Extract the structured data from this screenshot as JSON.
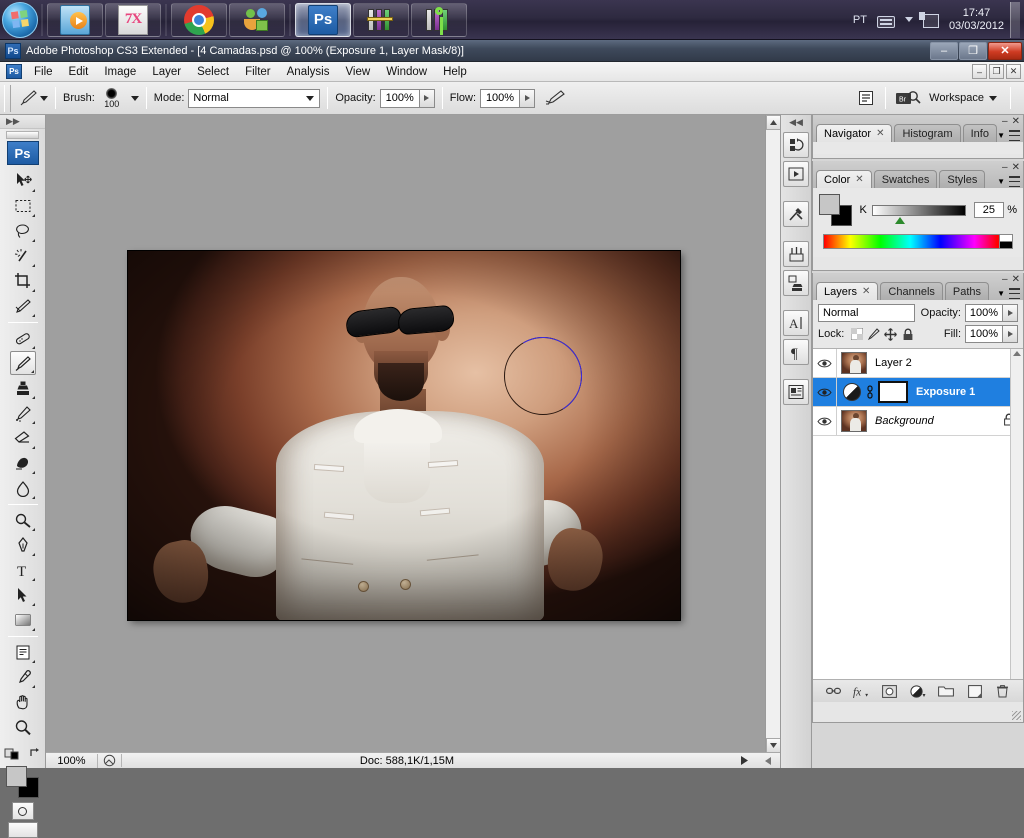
{
  "taskbar": {
    "start_label": "Start",
    "buttons": [
      {
        "name": "media-player",
        "label": "Windows Media Player"
      },
      {
        "name": "7x-app",
        "label": "7X"
      },
      {
        "name": "google-chrome",
        "label": "Google Chrome"
      },
      {
        "name": "messenger",
        "label": "Messenger"
      },
      {
        "name": "photoshop",
        "label": "Ps",
        "active": true
      },
      {
        "name": "winrar",
        "label": "WinRAR"
      },
      {
        "name": "winrar-key",
        "label": "WinRAR Key"
      }
    ],
    "tray": {
      "language": "PT",
      "keyboard_icon": "keyboard-icon",
      "network_icon": "network-icon",
      "time": "17:47",
      "date": "03/03/2012"
    }
  },
  "window": {
    "app_badge": "Ps",
    "title": "Adobe Photoshop CS3 Extended - [4 Camadas.psd @ 100% (Exposure 1, Layer Mask/8)]",
    "minimize": "–",
    "restore": "❐",
    "close": "✕"
  },
  "menubar": {
    "app_icon": "Ps",
    "items": [
      "File",
      "Edit",
      "Image",
      "Layer",
      "Select",
      "Filter",
      "Analysis",
      "View",
      "Window",
      "Help"
    ],
    "doc_minimize": "–",
    "doc_restore": "❐",
    "doc_close": "✕"
  },
  "optionsbar": {
    "tool_icon": "brush-tool-icon",
    "brush_label": "Brush:",
    "brush_size": "100",
    "mode_label": "Mode:",
    "mode_value": "Normal",
    "opacity_label": "Opacity:",
    "opacity_value": "100%",
    "flow_label": "Flow:",
    "flow_value": "100%",
    "airbrush_icon": "airbrush-icon",
    "palettes_icon": "palettes-toggle-icon",
    "bridge_icon": "go-to-bridge-icon",
    "workspace_label": "Workspace"
  },
  "toolbox": {
    "collapse_icon": "collapse-arrows-icon",
    "app_button": "Ps",
    "tools": [
      {
        "name": "move-tool",
        "label": "Move Tool"
      },
      {
        "name": "rectangular-marquee-tool",
        "label": "Rectangular Marquee Tool"
      },
      {
        "name": "lasso-tool",
        "label": "Lasso Tool"
      },
      {
        "name": "magic-wand-tool",
        "label": "Magic Wand Tool"
      },
      {
        "name": "crop-tool",
        "label": "Crop Tool"
      },
      {
        "name": "slice-tool",
        "label": "Slice Tool"
      },
      {
        "name": "healing-brush-tool",
        "label": "Spot Healing Brush Tool"
      },
      {
        "name": "brush-tool",
        "label": "Brush Tool",
        "selected": true
      },
      {
        "name": "clone-stamp-tool",
        "label": "Clone Stamp Tool"
      },
      {
        "name": "history-brush-tool",
        "label": "History Brush Tool"
      },
      {
        "name": "eraser-tool",
        "label": "Eraser Tool"
      },
      {
        "name": "gradient-tool",
        "label": "Gradient Tool"
      },
      {
        "name": "blur-tool",
        "label": "Blur Tool"
      },
      {
        "name": "dodge-tool",
        "label": "Dodge Tool"
      },
      {
        "name": "pen-tool",
        "label": "Pen Tool"
      },
      {
        "name": "type-tool",
        "label": "Horizontal Type Tool"
      },
      {
        "name": "path-selection-tool",
        "label": "Path Selection Tool"
      },
      {
        "name": "rectangle-tool",
        "label": "Rectangle Tool"
      },
      {
        "name": "notes-tool",
        "label": "Notes Tool"
      },
      {
        "name": "eyedropper-tool",
        "label": "Eyedropper Tool"
      },
      {
        "name": "hand-tool",
        "label": "Hand Tool"
      },
      {
        "name": "zoom-tool",
        "label": "Zoom Tool"
      }
    ],
    "foreground_color": "#c6c6c6",
    "background_color": "#000000",
    "quickmask_icon": "quick-mask-icon",
    "screenmode_icon": "screen-mode-icon"
  },
  "document": {
    "zoom": "100%",
    "doc_info": "Doc: 588,1K/1,15M",
    "canvas_alt": "Portrait of a man in a white coat on a warm brown gradient background",
    "brush_cursor": "brush-cursor-circle"
  },
  "vdock": {
    "buttons": [
      {
        "name": "history-panel-icon",
        "label": "History"
      },
      {
        "name": "actions-panel-icon",
        "label": "Actions"
      },
      {
        "name": "tool-presets-panel-icon",
        "label": "Tool Presets"
      },
      {
        "name": "brushes-panel-icon",
        "label": "Brushes"
      },
      {
        "name": "clone-source-panel-icon",
        "label": "Clone Source"
      },
      {
        "name": "character-panel-icon",
        "label": "Character"
      },
      {
        "name": "paragraph-panel-icon",
        "label": "Paragraph"
      },
      {
        "name": "layer-comps-panel-icon",
        "label": "Layer Comps"
      }
    ]
  },
  "navigator_panel": {
    "tabs": [
      {
        "label": "Navigator",
        "active": true,
        "closable": true
      },
      {
        "label": "Histogram",
        "active": false
      },
      {
        "label": "Info",
        "active": false
      }
    ],
    "minimize": "–",
    "close": "✕"
  },
  "color_panel": {
    "tabs": [
      {
        "label": "Color",
        "active": true,
        "closable": true
      },
      {
        "label": "Swatches",
        "active": false
      },
      {
        "label": "Styles",
        "active": false
      }
    ],
    "minimize": "–",
    "close": "✕",
    "channel_label": "K",
    "channel_value": "25",
    "percent_sign": "%",
    "foreground_color": "#c6c6c6",
    "background_color": "#000000"
  },
  "layers_panel": {
    "tabs": [
      {
        "label": "Layers",
        "active": true,
        "closable": true
      },
      {
        "label": "Channels",
        "active": false
      },
      {
        "label": "Paths",
        "active": false
      }
    ],
    "minimize": "–",
    "close": "✕",
    "blend_mode": "Normal",
    "opacity_label": "Opacity:",
    "opacity_value": "100%",
    "lock_label": "Lock:",
    "fill_label": "Fill:",
    "fill_value": "100%",
    "lock_icons": [
      "lock-transparent-pixels-icon",
      "lock-image-pixels-icon",
      "lock-position-icon",
      "lock-all-icon"
    ],
    "layers": [
      {
        "name": "Layer 2",
        "type": "image",
        "visible": true,
        "selected": false,
        "locked": false
      },
      {
        "name": "Exposure 1",
        "type": "adjustment",
        "visible": true,
        "selected": true,
        "locked": false,
        "has_mask": true,
        "linked": true
      },
      {
        "name": "Background",
        "type": "image",
        "visible": true,
        "selected": false,
        "locked": true,
        "italic": true
      }
    ],
    "footer_buttons": [
      {
        "name": "link-layers-icon",
        "label": "Link layers"
      },
      {
        "name": "layer-style-icon",
        "label": "fx"
      },
      {
        "name": "add-layer-mask-icon",
        "label": "Add layer mask"
      },
      {
        "name": "new-adjustment-layer-icon",
        "label": "New adjustment layer"
      },
      {
        "name": "new-group-icon",
        "label": "New group"
      },
      {
        "name": "new-layer-icon",
        "label": "New layer"
      },
      {
        "name": "delete-layer-icon",
        "label": "Delete layer"
      }
    ]
  }
}
